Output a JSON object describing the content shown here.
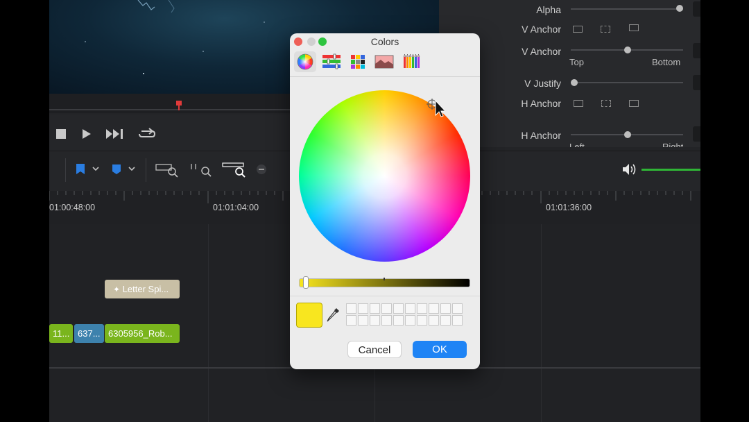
{
  "dialog": {
    "title": "Colors",
    "tabs": [
      "color-wheel",
      "color-sliders",
      "color-palettes",
      "image-palettes",
      "pencils"
    ],
    "current_color": "#f8e61f",
    "buttons": {
      "cancel": "Cancel",
      "ok": "OK"
    }
  },
  "inspector": {
    "alpha": "Alpha",
    "v_anchor_1": "V Anchor",
    "v_anchor_2": "V Anchor",
    "top": "Top",
    "bottom": "Bottom",
    "v_justify": "V Justify",
    "h_anchor_1": "H Anchor",
    "h_anchor_2": "H Anchor",
    "left": "Left",
    "right": "Right"
  },
  "timeline": {
    "timecodes": [
      "01:00:48:00",
      "01:01:04:00",
      "01:01:36:00"
    ],
    "clips": {
      "title_clip": "Letter Spi...",
      "video_1": "11...",
      "video_2": "637...",
      "video_3": "6305956_Rob..."
    }
  },
  "colors": {
    "accent_blue": "#1f84f5",
    "clip_green": "#7ab51d",
    "clip_blue": "#3d82ad",
    "title_clip": "#c8bfa5"
  }
}
